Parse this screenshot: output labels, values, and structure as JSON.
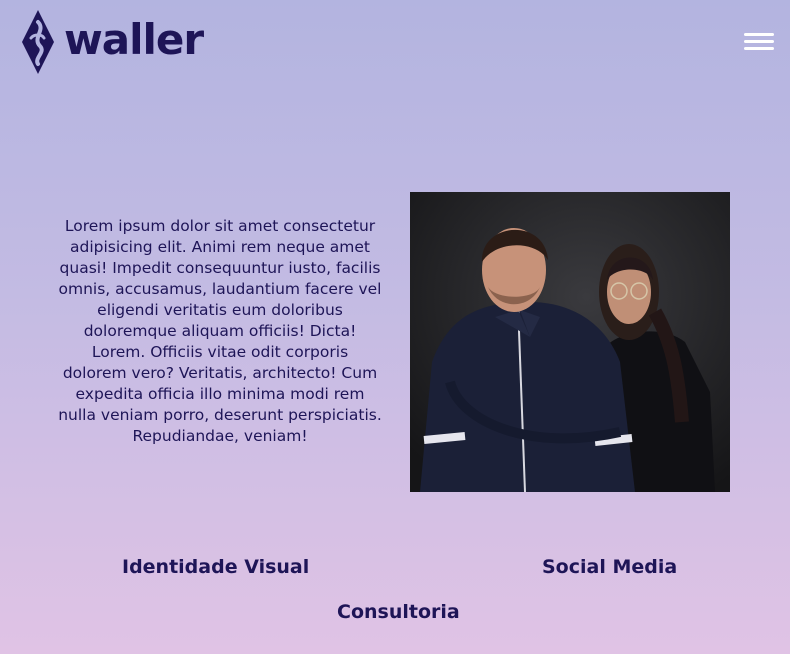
{
  "header": {
    "logo_text": "waller",
    "logo_icon": "diamond-swirl-logo-icon",
    "menu_icon": "hamburger-menu-icon"
  },
  "about": {
    "text": "Lorem ipsum dolor sit amet consectetur adipisicing elit. Animi rem neque amet quasi! Impedit consequuntur iusto, facilis omnis, accusamus, laudantium facere vel eligendi veritatis eum doloribus doloremque aliquam officiis! Dicta! Lorem. Officiis vitae odit corporis dolorem vero? Veritatis, architecto! Cum expedita officia illo minima modi rem nulla veniam porro, deserunt perspiciatis. Repudiandae, veniam!"
  },
  "services": [
    {
      "label": "Identidade Visual"
    },
    {
      "label": "Social Media"
    },
    {
      "label": "Consultoria"
    }
  ],
  "colors": {
    "brand": "#1e1557",
    "background_top": "#b3b4e0",
    "background_bottom": "#e0c3e5",
    "menu_icon": "#ffffff"
  }
}
